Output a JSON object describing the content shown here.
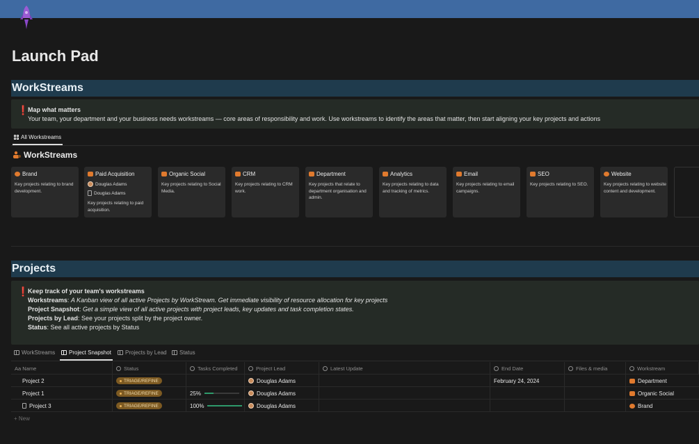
{
  "page": {
    "title": "Launch Pad"
  },
  "workstreams_section": {
    "heading": "WorkStreams",
    "callout_title": "Map what matters",
    "callout_text": "Your team, your department and your business needs workstreams — core areas of responsibility and work. Use workstreams to identify the areas that matter, then start aligning your key projects and actions",
    "tab_label": "All Workstreams",
    "board_title": "WorkStreams",
    "cards": [
      {
        "title": "Brand",
        "icon": "gem-icon",
        "color": "#e07a2e",
        "desc": "Key projects relating to brand development.",
        "people": []
      },
      {
        "title": "Paid Acquisition",
        "icon": "money-icon",
        "color": "#e07a2e",
        "desc": "Key projects relating to paid acquisition.",
        "people": [
          {
            "kind": "avatar",
            "name": "Douglas Adams"
          },
          {
            "kind": "doc",
            "name": "Douglas Adams"
          }
        ]
      },
      {
        "title": "Organic Social",
        "icon": "video-icon",
        "color": "#e07a2e",
        "desc": "Key projects relating to Social Media.",
        "people": []
      },
      {
        "title": "CRM",
        "icon": "database-icon",
        "color": "#e07a2e",
        "desc": "Key projects relating to CRM work.",
        "people": []
      },
      {
        "title": "Department",
        "icon": "people-icon",
        "color": "#e07a2e",
        "desc": "Key projects that relate to department organisation and admin.",
        "people": []
      },
      {
        "title": "Analytics",
        "icon": "database-icon",
        "color": "#e07a2e",
        "desc": "Key projects relating to data and tracking of metrics.",
        "people": []
      },
      {
        "title": "Email",
        "icon": "laptop-icon",
        "color": "#e07a2e",
        "desc": "Key projects relating to email campaigns.",
        "people": []
      },
      {
        "title": "SEO",
        "icon": "database-icon",
        "color": "#e07a2e",
        "desc": "Key projects relating to SEO.",
        "people": []
      },
      {
        "title": "Website",
        "icon": "globe-icon",
        "color": "#e07a2e",
        "desc": "Key projects relating to website content and development.",
        "people": []
      }
    ]
  },
  "projects_section": {
    "heading": "Projects",
    "callout_title": "Keep track of your team's workstreams",
    "lines": [
      {
        "label": "Workstreams",
        "sep": ": ",
        "text": "A Kanban view of all active Projects by WorkStream. Get immediate visibility of resource allocation for key projects",
        "italic": true
      },
      {
        "label": "Project Snapshot",
        "sep": ": ",
        "text": "Get a simple view of all active projects with project leads, key updates and task completion states.",
        "italic": true
      },
      {
        "label": "Projects by Lead",
        "sep": ": ",
        "text": "See your projects split by the project owner.",
        "italic": false
      },
      {
        "label": "Status",
        "sep": ": ",
        "text": "See all active projects by Status",
        "italic": false
      }
    ],
    "tabs": [
      "WorkStreams",
      "Project Snapshot",
      "Projects by Lead",
      "Status"
    ],
    "active_tab": 1,
    "columns": [
      "Aa Name",
      "Status",
      "Tasks Completed",
      "Project Lead",
      "Latest Update",
      "End Date",
      "Files & media",
      "Workstream"
    ],
    "rows": [
      {
        "name": "Project 2",
        "doc": false,
        "status": "TRIAGE/REFINE",
        "tasks": "",
        "progress": 0,
        "lead": "Douglas Adams",
        "update": "",
        "end_date": "February 24, 2024",
        "files": "",
        "workstream": "Department",
        "ws_icon": "people-icon"
      },
      {
        "name": "Project 1",
        "doc": false,
        "status": "TRIAGE/REFINE",
        "tasks": "25%",
        "progress": 0.25,
        "lead": "Douglas Adams",
        "update": "",
        "end_date": "",
        "files": "",
        "workstream": "Organic Social",
        "ws_icon": "video-icon"
      },
      {
        "name": "Project 3",
        "doc": true,
        "status": "TRIAGE/REFINE",
        "tasks": "100%",
        "progress": 1.0,
        "lead": "Douglas Adams",
        "update": "",
        "end_date": "",
        "files": "",
        "workstream": "Brand",
        "ws_icon": "gem-icon"
      }
    ],
    "new_label": "+ New"
  },
  "colors": {
    "cover": "#3f6aa2",
    "section_bar": "#1f3b4d",
    "badge": "#7d5a22",
    "progress": "#2e9a6b",
    "icon_accent": "#e07a2e",
    "rocket": "#9b5bd4"
  }
}
